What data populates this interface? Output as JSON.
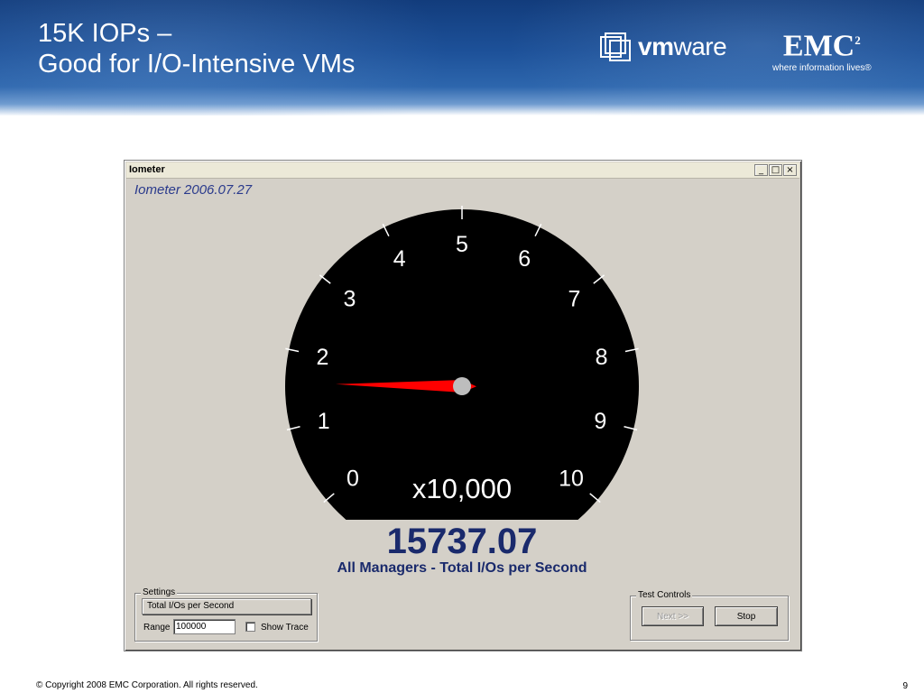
{
  "slide": {
    "title_line1": "15K IOPs –",
    "title_line2": "Good for I/O-Intensive VMs",
    "vmware_logo_text_bold": "vm",
    "vmware_logo_text": "ware",
    "emc_logo_text": "EMC",
    "emc_logo_superscript": "2",
    "emc_tagline": "where information lives®"
  },
  "window": {
    "title": "Iometer",
    "minimize_glyph": "_",
    "maximize_glyph": "□",
    "close_glyph": "×",
    "app_version_label": "Iometer 2006.07.27"
  },
  "gauge": {
    "scale_labels": [
      "0",
      "1",
      "2",
      "3",
      "4",
      "5",
      "6",
      "7",
      "8",
      "9",
      "10"
    ],
    "multiplier_label": "x10,000",
    "needle_value": 1.573707,
    "scale_max": 10,
    "dial_color": "#000000",
    "needle_color": "#ff0000",
    "readout_value": "15737.07",
    "readout_caption": "All Managers - Total I/Os per Second"
  },
  "settings": {
    "legend": "Settings",
    "metric_selected": "Total I/Os per Second",
    "range_label": "Range",
    "range_value": "100000",
    "show_trace_label": "Show Trace",
    "show_trace_checked": false
  },
  "test_controls": {
    "legend": "Test Controls",
    "next_label": "Next >>",
    "stop_label": "Stop"
  },
  "footer": {
    "copyright": "© Copyright 2008 EMC Corporation. All rights reserved.",
    "page_number": "9"
  }
}
